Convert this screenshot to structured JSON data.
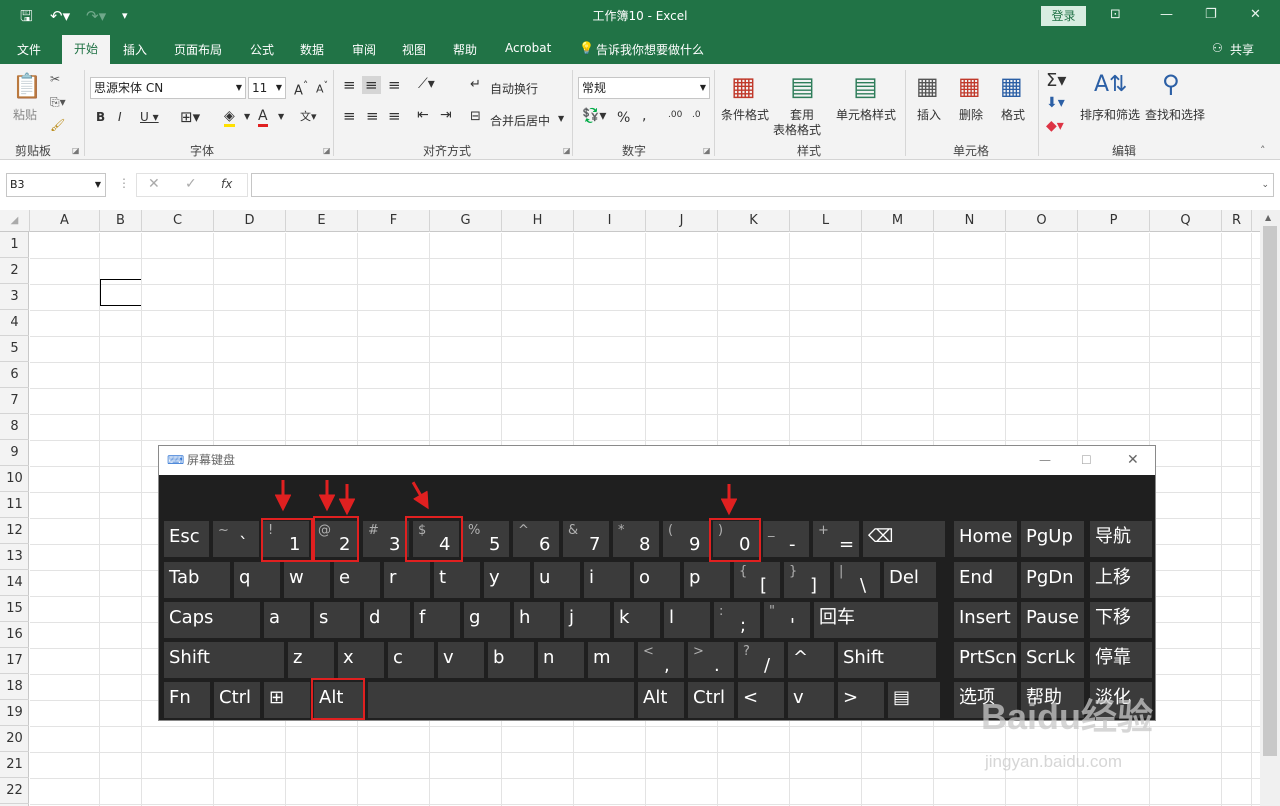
{
  "window": {
    "title": "工作簿10  -  Excel",
    "login": "登录"
  },
  "tabs": [
    "文件",
    "开始",
    "插入",
    "页面布局",
    "公式",
    "数据",
    "审阅",
    "视图",
    "帮助",
    "Acrobat",
    "告诉我你想要做什么"
  ],
  "share": "共享",
  "ribbon": {
    "paste": "粘贴",
    "clipboard": "剪贴板",
    "font_name": "思源宋体 CN",
    "font_size": "11",
    "font": "字体",
    "wrap": "自动换行",
    "merge": "合并后居中",
    "align": "对齐方式",
    "number_format": "常规",
    "number": "数字",
    "cond": "条件格式",
    "table1": "套用",
    "table2": "表格格式",
    "cellstyle": "单元格样式",
    "styles": "样式",
    "insert": "插入",
    "delete": "删除",
    "format": "格式",
    "cells": "单元格",
    "sort": "排序和筛选",
    "find": "查找和选择",
    "edit": "编辑"
  },
  "namebox": "B3",
  "columns": [
    "A",
    "B",
    "C",
    "D",
    "E",
    "F",
    "G",
    "H",
    "I",
    "J",
    "K",
    "L",
    "M",
    "N",
    "O",
    "P",
    "Q",
    "R"
  ],
  "rows": [
    "1",
    "2",
    "3",
    "4",
    "5",
    "6",
    "7",
    "8",
    "9",
    "10",
    "11",
    "12",
    "13",
    "14",
    "15",
    "16",
    "17",
    "18",
    "19",
    "20",
    "21",
    "22"
  ],
  "osk": {
    "title": "屏幕键盘",
    "row1": [
      {
        "m": "Esc"
      },
      {
        "s": "~",
        "l": "`"
      },
      {
        "s": "!",
        "l": "1"
      },
      {
        "s": "@",
        "l": "2"
      },
      {
        "s": "#",
        "l": "3"
      },
      {
        "s": "$",
        "l": "4"
      },
      {
        "s": "%",
        "l": "5"
      },
      {
        "s": "^",
        "l": "6"
      },
      {
        "s": "&",
        "l": "7"
      },
      {
        "s": "*",
        "l": "8"
      },
      {
        "s": "(",
        "l": "9"
      },
      {
        "s": ")",
        "l": "0"
      },
      {
        "s": "_",
        "l": "-"
      },
      {
        "s": "+",
        "l": "="
      },
      {
        "m": "⌫"
      }
    ],
    "row2": [
      {
        "m": "Tab"
      },
      {
        "m": "q"
      },
      {
        "m": "w"
      },
      {
        "m": "e"
      },
      {
        "m": "r"
      },
      {
        "m": "t"
      },
      {
        "m": "y"
      },
      {
        "m": "u"
      },
      {
        "m": "i"
      },
      {
        "m": "o"
      },
      {
        "m": "p"
      },
      {
        "s": "{",
        "l": "["
      },
      {
        "s": "}",
        "l": "]"
      },
      {
        "s": "|",
        "l": "\\"
      },
      {
        "m": "Del"
      }
    ],
    "row3": [
      {
        "m": "Caps"
      },
      {
        "m": "a"
      },
      {
        "m": "s"
      },
      {
        "m": "d"
      },
      {
        "m": "f"
      },
      {
        "m": "g"
      },
      {
        "m": "h"
      },
      {
        "m": "j"
      },
      {
        "m": "k"
      },
      {
        "m": "l"
      },
      {
        "s": ":",
        "l": ";"
      },
      {
        "s": "\"",
        "l": "'"
      },
      {
        "m": "回车"
      }
    ],
    "row4": [
      {
        "m": "Shift"
      },
      {
        "m": "z"
      },
      {
        "m": "x"
      },
      {
        "m": "c"
      },
      {
        "m": "v"
      },
      {
        "m": "b"
      },
      {
        "m": "n"
      },
      {
        "m": "m"
      },
      {
        "s": "<",
        "l": ","
      },
      {
        "s": ">",
        "l": "."
      },
      {
        "s": "?",
        "l": "/"
      },
      {
        "m": "^"
      },
      {
        "m": "Shift"
      }
    ],
    "row5": [
      {
        "m": "Fn"
      },
      {
        "m": "Ctrl"
      },
      {
        "m": "⊞"
      },
      {
        "m": "Alt"
      },
      {
        "m": ""
      },
      {
        "m": "Alt"
      },
      {
        "m": "Ctrl"
      },
      {
        "m": "<"
      },
      {
        "m": "v"
      },
      {
        "m": ">"
      },
      {
        "m": "▤"
      }
    ],
    "nav": [
      [
        "Home",
        "PgUp",
        "导航"
      ],
      [
        "End",
        "PgDn",
        "上移"
      ],
      [
        "Insert",
        "Pause",
        "下移"
      ],
      [
        "PrtScn",
        "ScrLk",
        "停靠"
      ],
      [
        "选项",
        "帮助",
        "淡化"
      ]
    ]
  },
  "watermark": {
    "brand": "Baidu经验",
    "url": "jingyan.baidu.com"
  }
}
